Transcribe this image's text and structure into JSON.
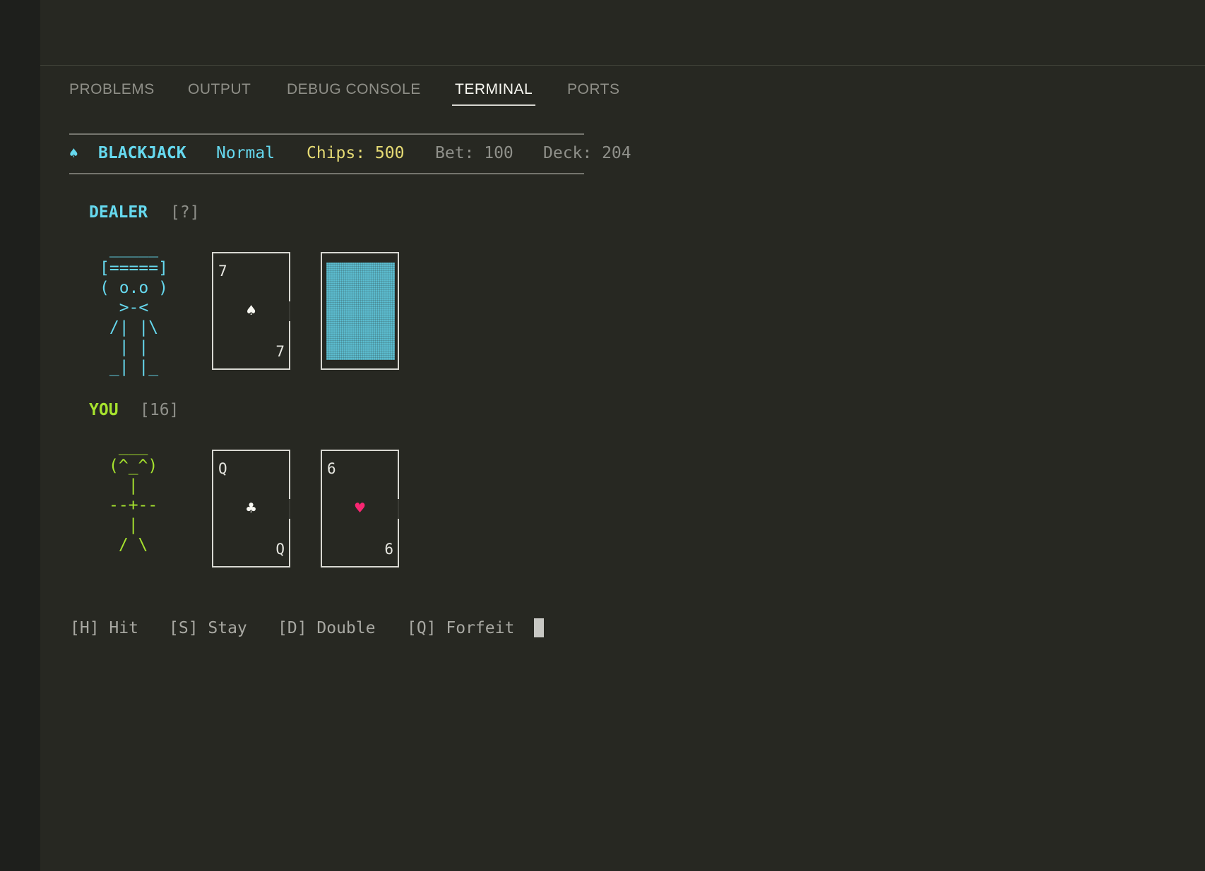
{
  "panel": {
    "tabs": [
      {
        "label": "PROBLEMS",
        "active": false
      },
      {
        "label": "OUTPUT",
        "active": false
      },
      {
        "label": "DEBUG CONSOLE",
        "active": false
      },
      {
        "label": "TERMINAL",
        "active": true
      },
      {
        "label": "PORTS",
        "active": false
      }
    ]
  },
  "game": {
    "status": {
      "suit_icon": "♠",
      "title": "BLACKJACK",
      "mode": "Normal",
      "chips": "Chips: 500",
      "bet": "Bet: 100",
      "deck": "Deck: 204"
    },
    "dealer": {
      "label": "DEALER",
      "score": "[?]",
      "ascii_art": " _____\n[=====]\n( o.o )\n  >-<\n /| |\\\n  | |\n _| |_",
      "cards": [
        {
          "rank": "7",
          "suit": "♠",
          "suit_name": "spade-icon",
          "suit_color": "#f8f8f2",
          "face_down": false
        },
        {
          "face_down": true,
          "back_color": "#5bbccf"
        }
      ]
    },
    "player": {
      "label": "YOU",
      "score": "[16]",
      "ascii_art": " ___\n(^_^)\n  |\n--+--\n  |\n / \\",
      "cards": [
        {
          "rank": "Q",
          "suit": "♣",
          "suit_name": "club-icon",
          "suit_color": "#f8f8f2",
          "face_down": false
        },
        {
          "rank": "6",
          "suit": "♥",
          "suit_name": "heart-icon",
          "suit_color": "#f92672",
          "face_down": false
        }
      ]
    },
    "controls": {
      "hit": "[H] Hit",
      "stay": "[S] Stay",
      "double": "[D] Double",
      "forfeit": "[Q] Forfeit"
    }
  },
  "colors": {
    "background": "#272822",
    "cyan": "#66d9ef",
    "yellow": "#e6db74",
    "green": "#a6e22e",
    "muted": "#8f908a",
    "heart": "#f92672"
  }
}
